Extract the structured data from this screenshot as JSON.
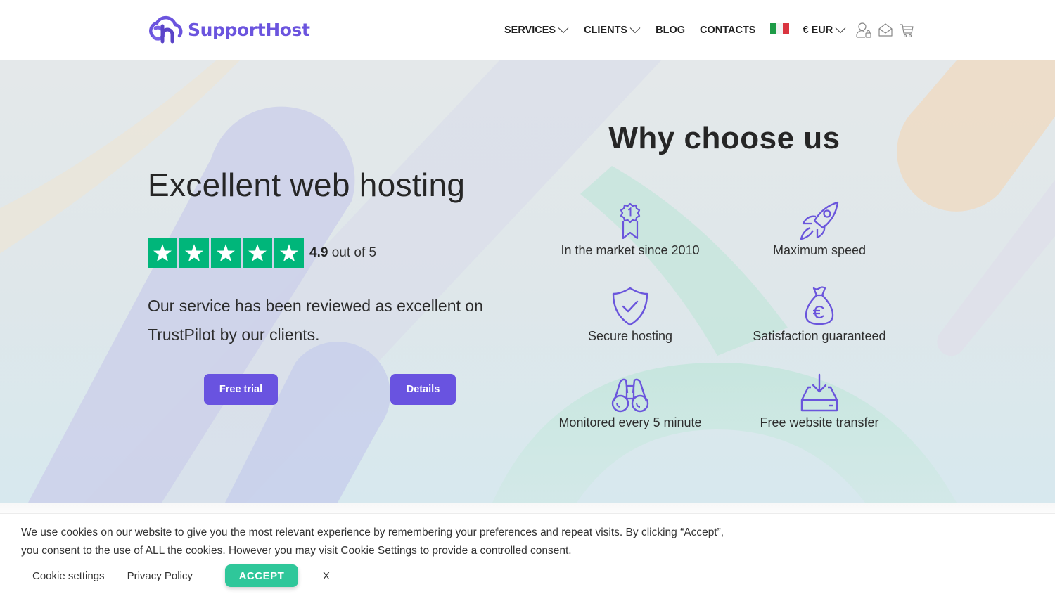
{
  "header": {
    "brand": "SupportHost",
    "nav": [
      {
        "label": "SERVICES",
        "dropdown": true
      },
      {
        "label": "CLIENTS",
        "dropdown": true
      },
      {
        "label": "BLOG",
        "dropdown": false
      },
      {
        "label": "CONTACTS",
        "dropdown": false
      }
    ],
    "language_flag": "italian-flag",
    "currency": "€ EUR",
    "icons": [
      "user-lock-icon",
      "envelope-icon",
      "cart-icon"
    ]
  },
  "hero": {
    "title": "Excellent web hosting",
    "rating": {
      "value": "4.9",
      "suffix": "out of 5",
      "stars": 5,
      "max": 5
    },
    "description": "Our service has been reviewed as excellent on TrustPilot by our clients.",
    "buttons": {
      "free_trial": "Free trial",
      "details": "Details"
    }
  },
  "why": {
    "title": "Why choose us",
    "features": [
      {
        "icon": "award-ribbon-icon",
        "label": "In the market since 2010"
      },
      {
        "icon": "rocket-icon",
        "label": "Maximum speed"
      },
      {
        "icon": "shield-check-icon",
        "label": "Secure hosting"
      },
      {
        "icon": "money-bag-euro-icon",
        "label": "Satisfaction guaranteed"
      },
      {
        "icon": "binoculars-icon",
        "label": "Monitored every 5 minute"
      },
      {
        "icon": "download-drive-icon",
        "label": "Free website transfer"
      }
    ]
  },
  "cookie_bar": {
    "text": "We use cookies on our website to give you the most relevant experience by remembering your preferences and repeat visits. By clicking “Accept”, you consent to the use of ALL the cookies. However you may visit Cookie Settings to provide a controlled consent.",
    "settings_label": "Cookie settings",
    "privacy_label": "Privacy Policy",
    "accept_label": "ACCEPT",
    "close_label": "X"
  },
  "colors": {
    "brand": "#6b54de",
    "button": "#6953e0",
    "trustpilot_green": "#00b67a",
    "accept_green": "#2fc79a",
    "icon_stroke": "#6a55dc"
  }
}
